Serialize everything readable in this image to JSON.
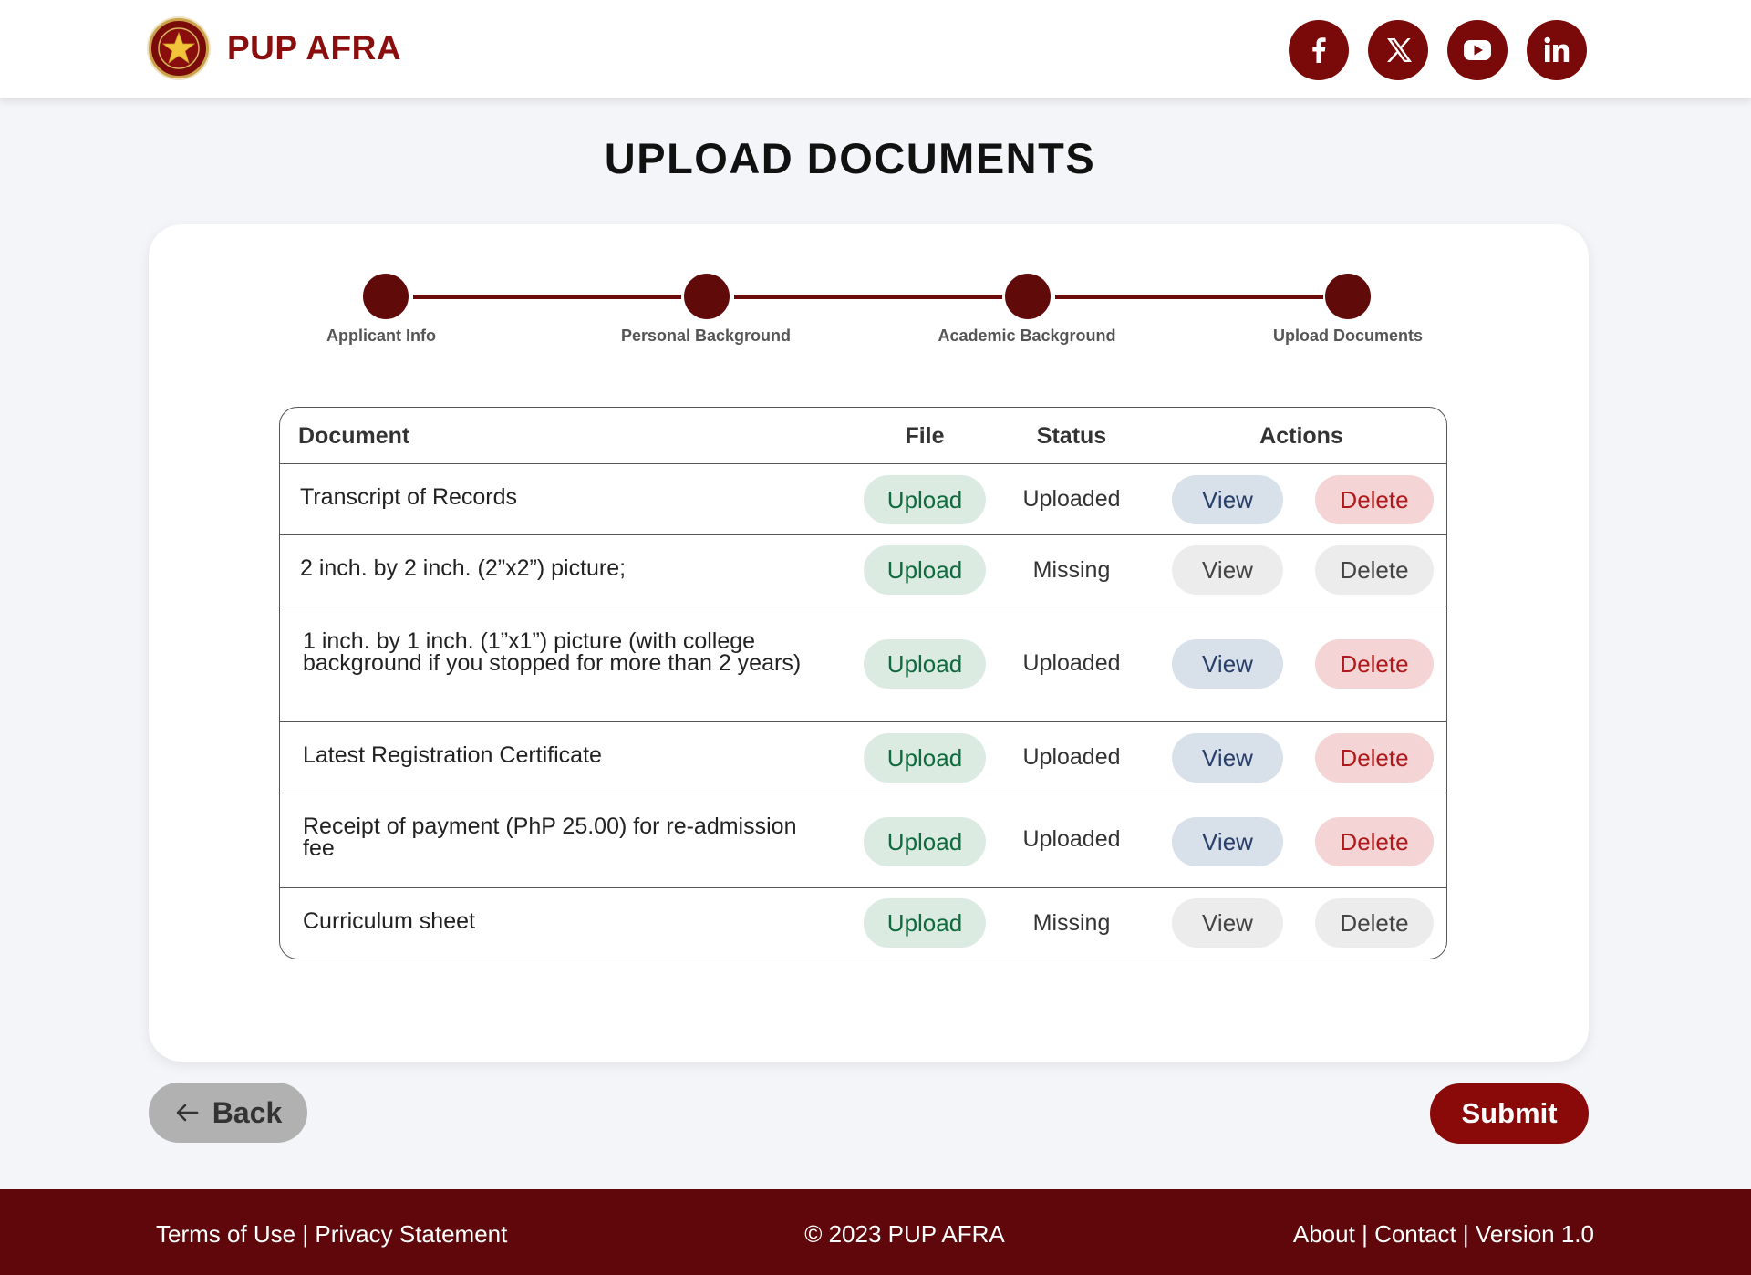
{
  "brand": {
    "name": "PUP AFRA"
  },
  "socials": [
    {
      "name": "facebook"
    },
    {
      "name": "x"
    },
    {
      "name": "youtube"
    },
    {
      "name": "linkedin"
    }
  ],
  "page": {
    "title": "UPLOAD DOCUMENTS"
  },
  "stepper": {
    "steps": [
      {
        "label": "Applicant Info",
        "complete": true
      },
      {
        "label": "Personal Background",
        "complete": true
      },
      {
        "label": "Academic Background",
        "complete": true
      },
      {
        "label": "Upload Documents",
        "complete": true
      }
    ]
  },
  "table": {
    "headers": {
      "document": "Document",
      "file": "File",
      "status": "Status",
      "actions": "Actions"
    },
    "rows": [
      {
        "document": "Transcript of Records",
        "upload": "Upload",
        "status": "Uploaded",
        "view": "View",
        "delete": "Delete"
      },
      {
        "document": "2 inch. by 2 inch. (2”x2”) picture;",
        "upload": "Upload",
        "status": "Missing",
        "view": "View",
        "delete": "Delete"
      },
      {
        "document": "1 inch. by 1 inch. (1”x1”) picture (with college background if you stopped for more than 2 years)",
        "upload": "Upload",
        "status": "Uploaded",
        "view": "View",
        "delete": "Delete"
      },
      {
        "document": "Latest Registration Certificate",
        "upload": "Upload",
        "status": "Uploaded",
        "view": "View",
        "delete": "Delete"
      },
      {
        "document": "Receipt of payment (PhP 25.00) for re-admission fee",
        "upload": "Upload",
        "status": "Uploaded",
        "view": "View",
        "delete": "Delete"
      },
      {
        "document": "Curriculum sheet",
        "upload": "Upload",
        "status": "Missing",
        "view": "View",
        "delete": "Delete"
      }
    ]
  },
  "actions": {
    "back": "Back",
    "submit": "Submit"
  },
  "footer": {
    "terms": "Terms of Use",
    "privacy": "Privacy Statement",
    "copyright": "© 2023 PUP AFRA",
    "about": "About",
    "contact": "Contact",
    "version": "Version 1.0",
    "separator": "|"
  },
  "colors": {
    "brand": "#8a0e0e",
    "footer": "#5f070a",
    "stepper": "#610a0a",
    "upload_bg": "#dcebe2",
    "view_active_bg": "#d8e0ea",
    "delete_active_bg": "#f4d4d4"
  }
}
